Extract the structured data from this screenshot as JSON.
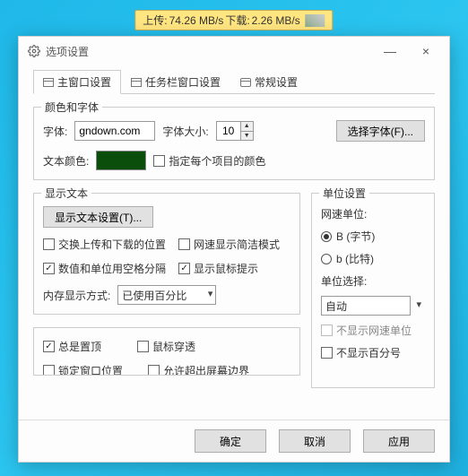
{
  "speed_bar": {
    "upload_label": "上传:",
    "upload_value": "74.26 MB/s",
    "download_label": "下载:",
    "download_value": "2.26 MB/s"
  },
  "window": {
    "title": "选项设置",
    "close": "×",
    "minimize": "—"
  },
  "tabs": {
    "main": "主窗口设置",
    "taskbar": "任务栏窗口设置",
    "general": "常规设置"
  },
  "group_font": {
    "title": "颜色和字体",
    "font_label": "字体:",
    "font_value": "gndown.com",
    "size_label": "字体大小:",
    "size_value": "10",
    "choose_font_btn": "选择字体(F)...",
    "text_color_label": "文本颜色:",
    "text_color_value": "#0b4d0b",
    "per_item_color": "指定每个项目的颜色"
  },
  "group_display": {
    "title": "显示文本",
    "display_settings_btn": "显示文本设置(T)...",
    "swap_ul_dl": "交换上传和下载的位置",
    "compact_speed": "网速显示简洁模式",
    "space_sep": "数值和单位用空格分隔",
    "show_tooltip": "显示鼠标提示",
    "mem_label": "内存显示方式:",
    "mem_value": "已使用百分比"
  },
  "group_unit": {
    "title": "单位设置",
    "speed_unit_label": "网速单位:",
    "radio_byte": "B (字节)",
    "radio_bit": "b (比特)",
    "unit_select_label": "单位选择:",
    "unit_select_value": "自动",
    "hide_speed_unit": "不显示网速单位",
    "hide_percent": "不显示百分号"
  },
  "group_misc": {
    "always_top": "总是置顶",
    "mouse_through": "鼠标穿透",
    "lock_pos": "锁定窗口位置",
    "allow_offscreen": "允许超出屏幕边界"
  },
  "buttons": {
    "ok": "确定",
    "cancel": "取消",
    "apply": "应用"
  }
}
